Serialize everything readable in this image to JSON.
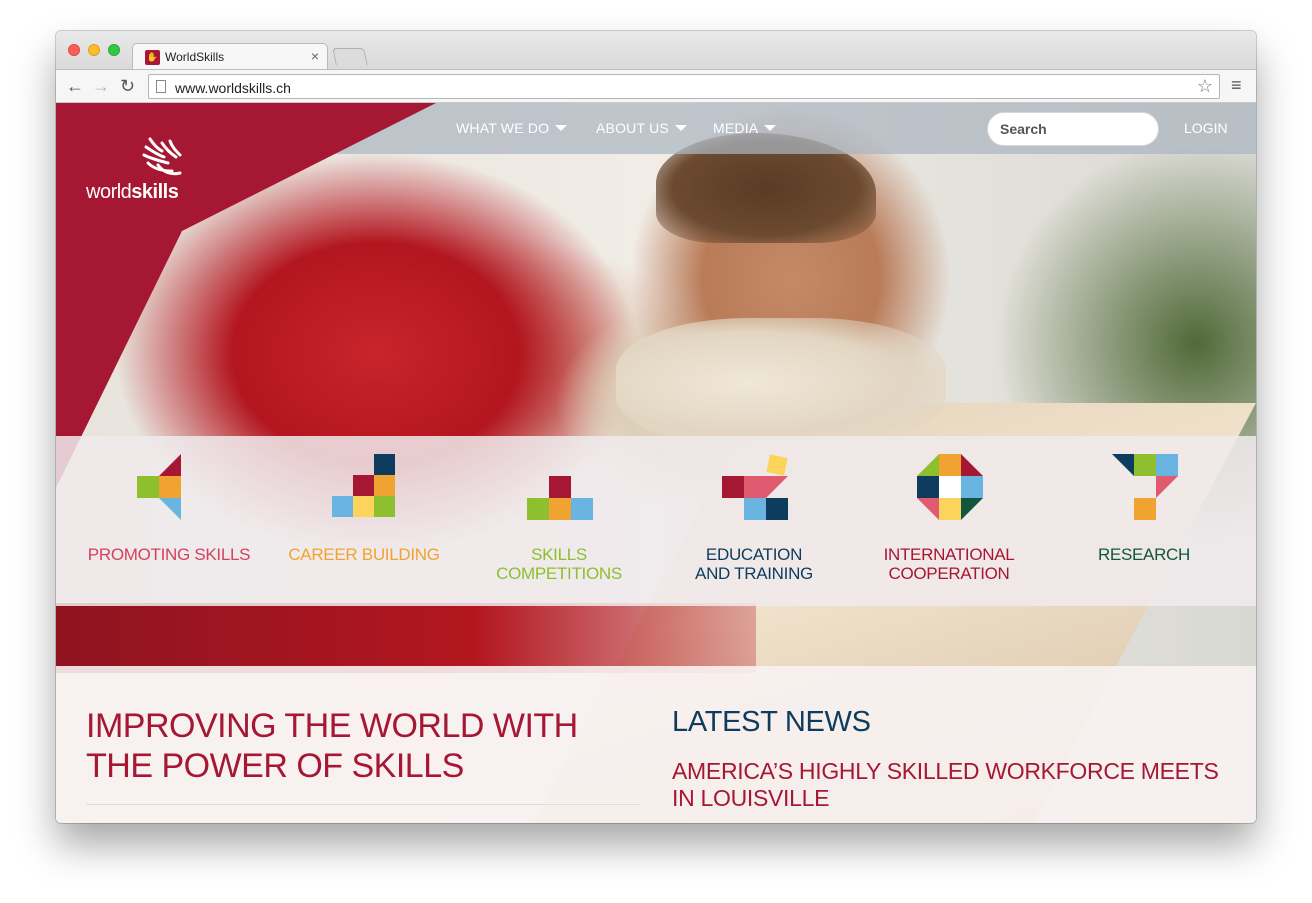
{
  "browser": {
    "tab_title": "WorldSkills",
    "tab_close": "×",
    "url": "www.worldskills.ch",
    "back_glyph": "←",
    "forward_glyph": "→",
    "reload_glyph": "↻",
    "star_glyph": "☆",
    "menu_glyph": "≡"
  },
  "site": {
    "logo": {
      "word1": "world",
      "word2": "skills"
    },
    "nav": [
      {
        "label": "WHAT WE DO",
        "has_dropdown": true
      },
      {
        "label": "ABOUT US",
        "has_dropdown": true
      },
      {
        "label": "MEDIA",
        "has_dropdown": true
      }
    ],
    "search_placeholder": "Search",
    "login": "LOGIN",
    "brand_color": "#a51733"
  },
  "pillars": [
    {
      "label": "PROMOTING SKILLS",
      "color": "#d4415e",
      "icon": "promoting-skills-icon"
    },
    {
      "label": "CAREER BUILDING",
      "color": "#f0a330",
      "icon": "career-building-icon"
    },
    {
      "label": "SKILLS COMPETITIONS",
      "color": "#8dbf2e",
      "icon": "skills-competitions-icon"
    },
    {
      "label": "EDUCATION AND TRAINING",
      "color": "#0e3c5e",
      "icon": "education-training-icon"
    },
    {
      "label": "INTERNATIONAL COOPERATION",
      "color": "#a51733",
      "icon": "international-cooperation-icon"
    },
    {
      "label": "RESEARCH",
      "color": "#11563f",
      "icon": "research-icon"
    }
  ],
  "main": {
    "mission": "IMPROVING THE WORLD WITH THE POWER OF SKILLS",
    "news_heading": "LATEST NEWS",
    "news_items": [
      {
        "title": "AMERICA’S HIGHLY SKILLED WORKFORCE MEETS IN LOUISVILLE"
      }
    ]
  }
}
